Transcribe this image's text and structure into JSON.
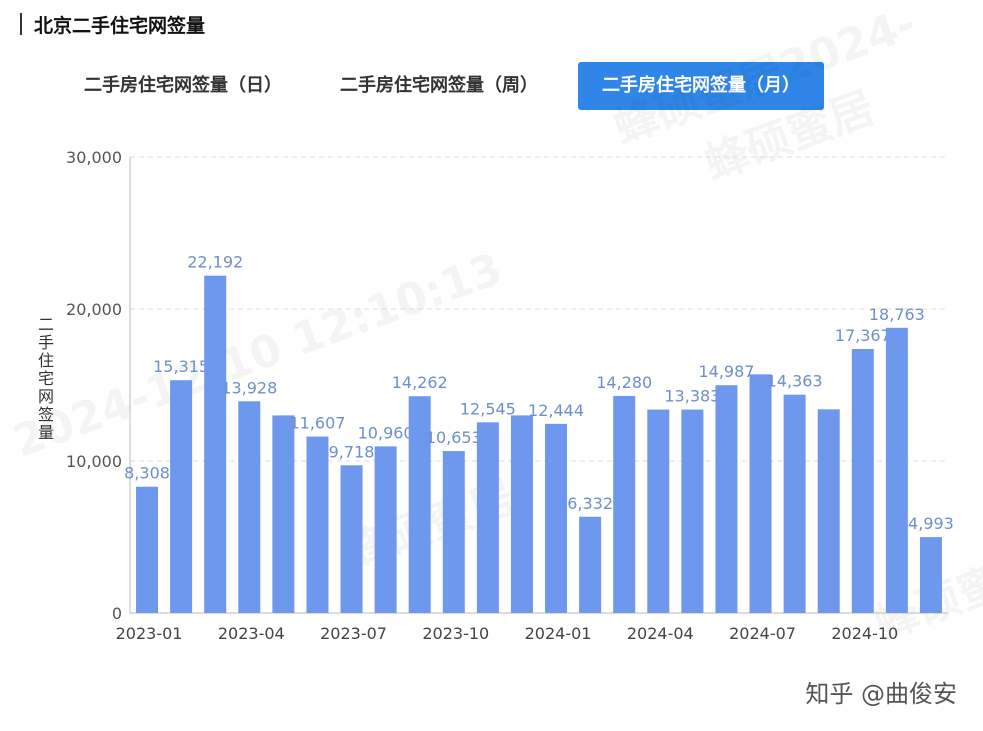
{
  "header": {
    "title": "北京二手住宅网签量"
  },
  "tabs": [
    {
      "label": "二手房住宅网签量（日）",
      "active": false
    },
    {
      "label": "二手房住宅网签量（周）",
      "active": false
    },
    {
      "label": "二手房住宅网签量（月）",
      "active": true
    }
  ],
  "watermarks": [
    "蜂硕蜜居2024-",
    "蜂硕蜜居",
    "2024-12-10 12:10:13",
    "蜂硕蜜居",
    "蜂硕蜜居"
  ],
  "credit": "知乎 @曲俊安",
  "colors": {
    "bar": "#6e97ee",
    "label": "#6f8fc8",
    "accent": "#2f86e8"
  },
  "chart_data": {
    "type": "bar",
    "ylabel": "二手住宅网签量",
    "ylim": [
      0,
      30000
    ],
    "yticks": [
      0,
      10000,
      20000,
      30000
    ],
    "ytick_labels": [
      "0",
      "10,000",
      "20,000",
      "30,000"
    ],
    "xtick_labels": [
      "2023-01",
      "2023-04",
      "2023-07",
      "2023-10",
      "2024-01",
      "2024-04",
      "2024-07",
      "2024-10"
    ],
    "categories": [
      "2023-01",
      "2023-02",
      "2023-03",
      "2023-04",
      "2023-05",
      "2023-06",
      "2023-07",
      "2023-08",
      "2023-09",
      "2023-10",
      "2023-11",
      "2023-12",
      "2024-01",
      "2024-02",
      "2024-03",
      "2024-04",
      "2024-05",
      "2024-06",
      "2024-07",
      "2024-08",
      "2024-09",
      "2024-10",
      "2024-11",
      "2024-12"
    ],
    "values": [
      8308,
      15315,
      22192,
      13928,
      13000,
      11607,
      9718,
      10960,
      14262,
      10653,
      12545,
      13000,
      12444,
      6332,
      14280,
      13383,
      13383,
      14987,
      15700,
      14363,
      13400,
      17367,
      18763,
      4993
    ],
    "data_labels": [
      "8,308",
      "15,315",
      "22,192",
      "13,928",
      "",
      "11,607",
      "9,718",
      "10,960",
      "14,262",
      "10,653",
      "12,545",
      "",
      "12,444",
      "6,332",
      "14,280",
      "",
      "13,383",
      "14,987",
      "",
      "14,363",
      "",
      "17,367",
      "18,763",
      "4,993"
    ]
  }
}
